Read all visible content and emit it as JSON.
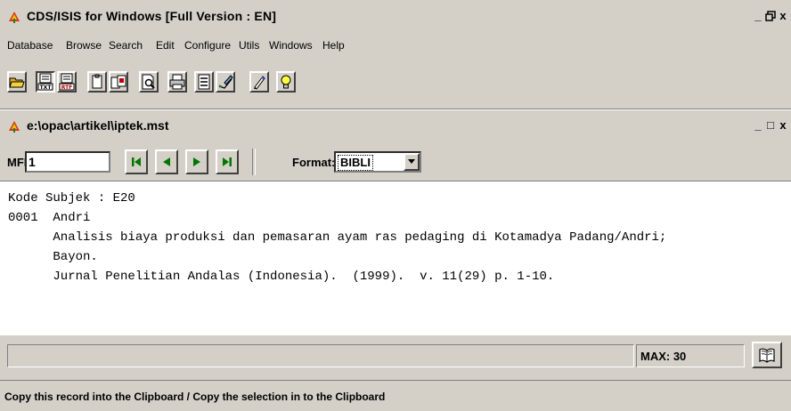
{
  "app": {
    "title": "CDS/ISIS for Windows [Full Version : EN]",
    "controls": [
      "_",
      " ",
      "x"
    ]
  },
  "menubar": {
    "items": [
      "Database",
      "Browse",
      "Search",
      "Edit",
      "Configure",
      "Utils",
      "Windows",
      "Help"
    ]
  },
  "toolbar": {
    "buttons": [
      {
        "icon": "open-folder-icon"
      },
      {
        "icon": "export-txt-icon",
        "badge": "TXT",
        "pressed": true
      },
      {
        "icon": "export-rtf-icon",
        "badge": "RTF"
      },
      {
        "icon": "clipboard-icon"
      },
      {
        "icon": "copy-selection-icon"
      },
      {
        "icon": "print-preview-icon"
      },
      {
        "icon": "printer-icon"
      },
      {
        "icon": "form-icon"
      },
      {
        "icon": "edit-record-icon"
      },
      {
        "icon": "pencil-icon"
      },
      {
        "icon": "lightbulb-icon"
      }
    ]
  },
  "child_window": {
    "title": "e:\\opac\\artikel\\iptek.mst",
    "controls": [
      "_",
      "□",
      "x"
    ]
  },
  "nav": {
    "mfn_label": "MFN",
    "mfn_value": "1",
    "buttons": [
      "first-record",
      "previous-record",
      "next-record",
      "last-record"
    ],
    "format_label": "Format:",
    "format_value": "BIBLI"
  },
  "record": {
    "text": "Kode Subjek : E20\n0001  Andri\n      Analisis biaya produksi dan pemasaran ayam ras pedaging di Kotamadya Padang/Andri;\n      Bayon.\n      Jurnal Penelitian Andalas (Indonesia).  (1999).  v. 11(29) p. 1-10."
  },
  "bottom": {
    "status_value": "",
    "max_label": "MAX: 30"
  },
  "statusbar": {
    "text": "Copy this record into the Clipboard / Copy the selection in to the Clipboard"
  }
}
